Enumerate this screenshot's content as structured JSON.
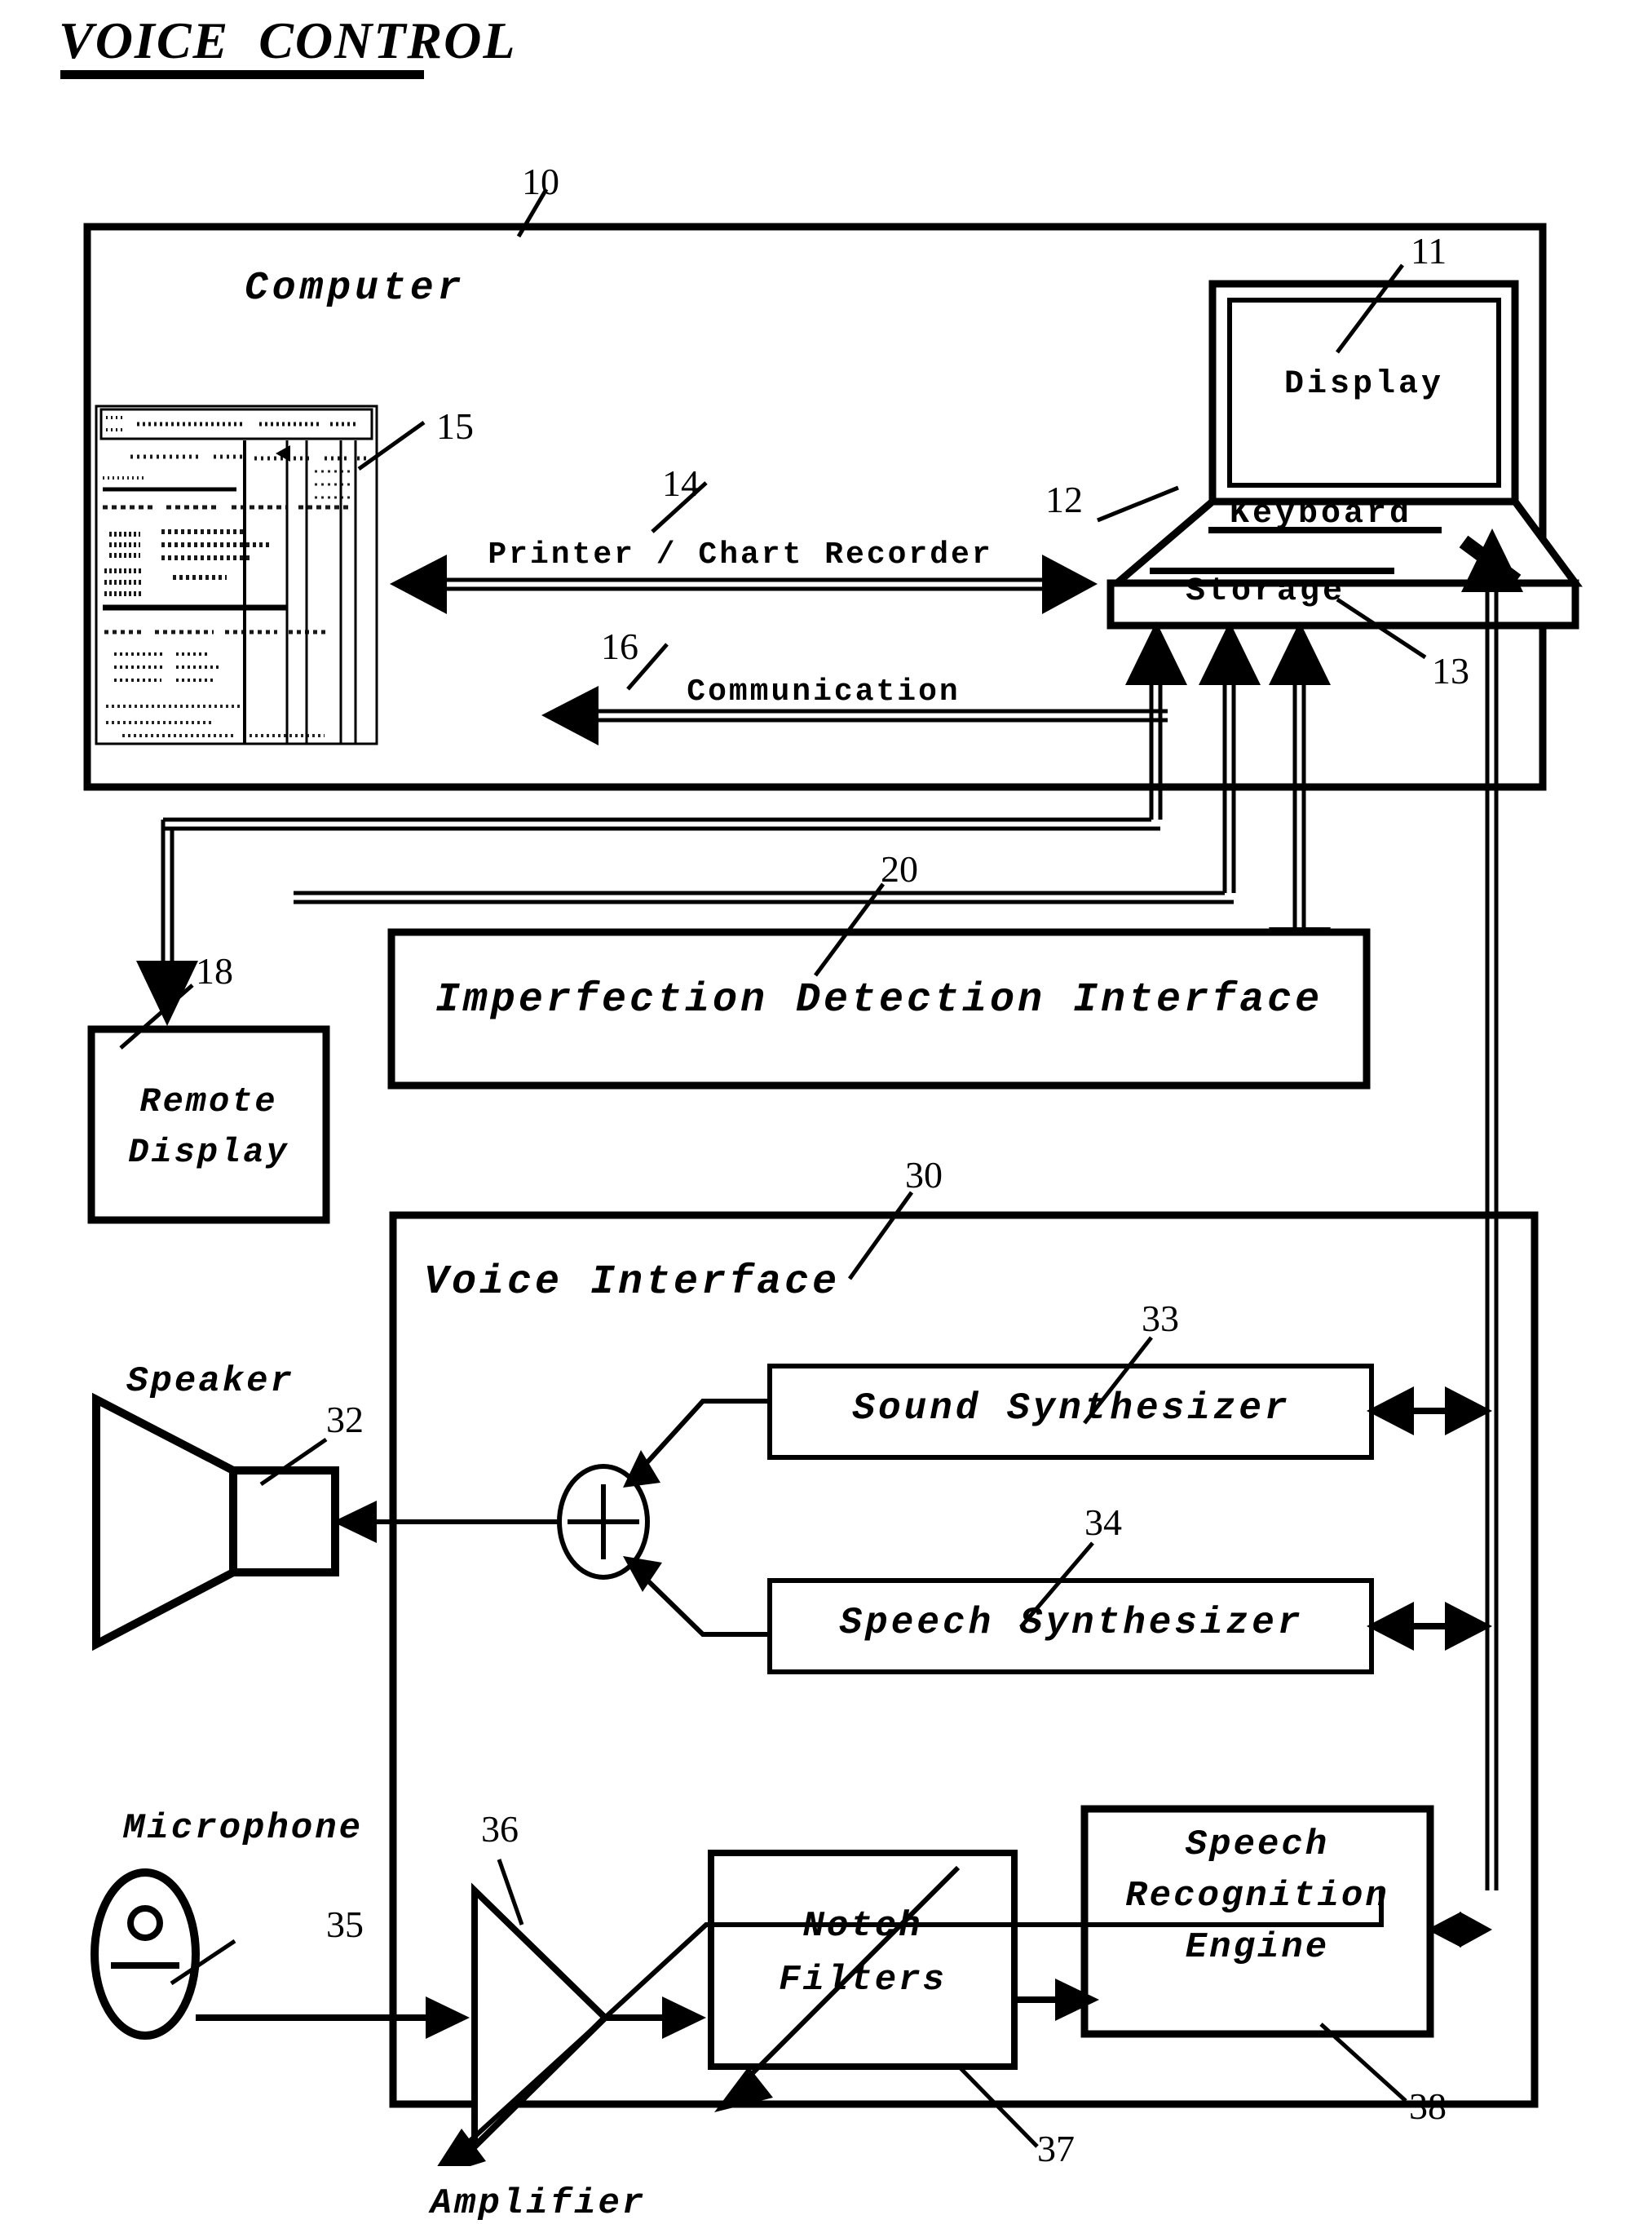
{
  "figure": {
    "title": "VOICE  CONTROL",
    "type": "patent-block-diagram"
  },
  "blocks": {
    "computer": {
      "label": "Computer",
      "ref": "10"
    },
    "display": {
      "label": "Display",
      "ref": "11"
    },
    "keyboard": {
      "label": "Keyboard",
      "ref": "12"
    },
    "storage": {
      "label": "Storage",
      "ref": "13"
    },
    "printer_document": {
      "ref": "15"
    },
    "remote_display": {
      "label_line1": "Remote",
      "label_line2": "Display",
      "ref": "18"
    },
    "imperfection_detection_interface": {
      "label": "Imperfection Detection Interface",
      "ref": "20"
    },
    "voice_interface": {
      "label": "Voice Interface",
      "ref": "30"
    },
    "speaker": {
      "label": "Speaker",
      "ref": "32"
    },
    "sound_synthesizer": {
      "label": "Sound Synthesizer",
      "ref": "33"
    },
    "speech_synthesizer": {
      "label": "Speech Synthesizer",
      "ref": "34"
    },
    "microphone": {
      "label": "Microphone",
      "ref": "35"
    },
    "amplifier": {
      "label": "Amplifier",
      "ref": "36"
    },
    "notch_filters": {
      "label_line1": "Notch",
      "label_line2": "Filters",
      "ref": "37"
    },
    "speech_recognition_engine": {
      "label_line1": "Speech",
      "label_line2": "Recognition",
      "label_line3": "Engine",
      "ref": "38"
    },
    "summing_junction": {
      "symbol": "+"
    }
  },
  "connections": {
    "printer_chart_recorder": {
      "label": "Printer / Chart Recorder",
      "ref": "14"
    },
    "communication": {
      "label": "Communication",
      "ref": "16"
    }
  },
  "colors": {
    "ink": "#000000",
    "paper": "#ffffff"
  }
}
